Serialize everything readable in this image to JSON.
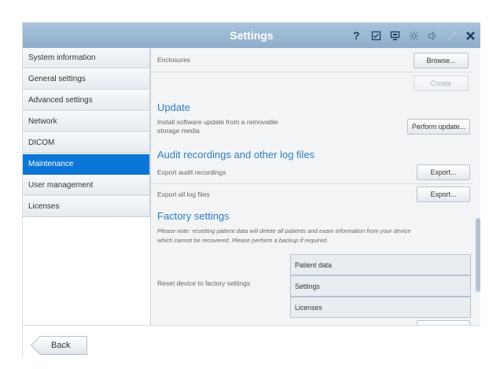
{
  "window": {
    "title": "Settings",
    "icons": [
      "help-icon",
      "checklist-icon",
      "display-icon",
      "brightness-icon",
      "volume-icon",
      "wrench-icon",
      "close-icon"
    ]
  },
  "sidebar": {
    "items": [
      {
        "label": "System information"
      },
      {
        "label": "General settings"
      },
      {
        "label": "Advanced settings"
      },
      {
        "label": "Network"
      },
      {
        "label": "DICOM"
      },
      {
        "label": "Maintenance",
        "active": true
      },
      {
        "label": "User management"
      },
      {
        "label": "Licenses"
      }
    ]
  },
  "main": {
    "enclosures_label": "Enclosures",
    "browse_button": "Browse...",
    "create_button": "Create",
    "update": {
      "heading": "Update",
      "desc_line1": "Install software update from a removable",
      "desc_line2": "storage media",
      "button": "Perform update..."
    },
    "audit": {
      "heading": "Audit recordings and other log files",
      "export_audit_label": "Export audit recordings",
      "export_audit_button": "Export...",
      "export_logs_label": "Export all log files",
      "export_logs_button": "Export..."
    },
    "factory": {
      "heading": "Factory settings",
      "note_line1": "Please note: resetting patient data will delete all patients and exam information from your device",
      "note_line2": "which cannot be recovered. Please perform a backup if required.",
      "reset_label": "Reset device to factory settings",
      "options": [
        "Patient data",
        "Settings",
        "Licenses"
      ]
    }
  },
  "footer": {
    "back_button": "Back"
  },
  "colors": {
    "titlebar": "#9ab7d2",
    "active_item": "#0c76d8",
    "heading": "#2f7ec0"
  }
}
